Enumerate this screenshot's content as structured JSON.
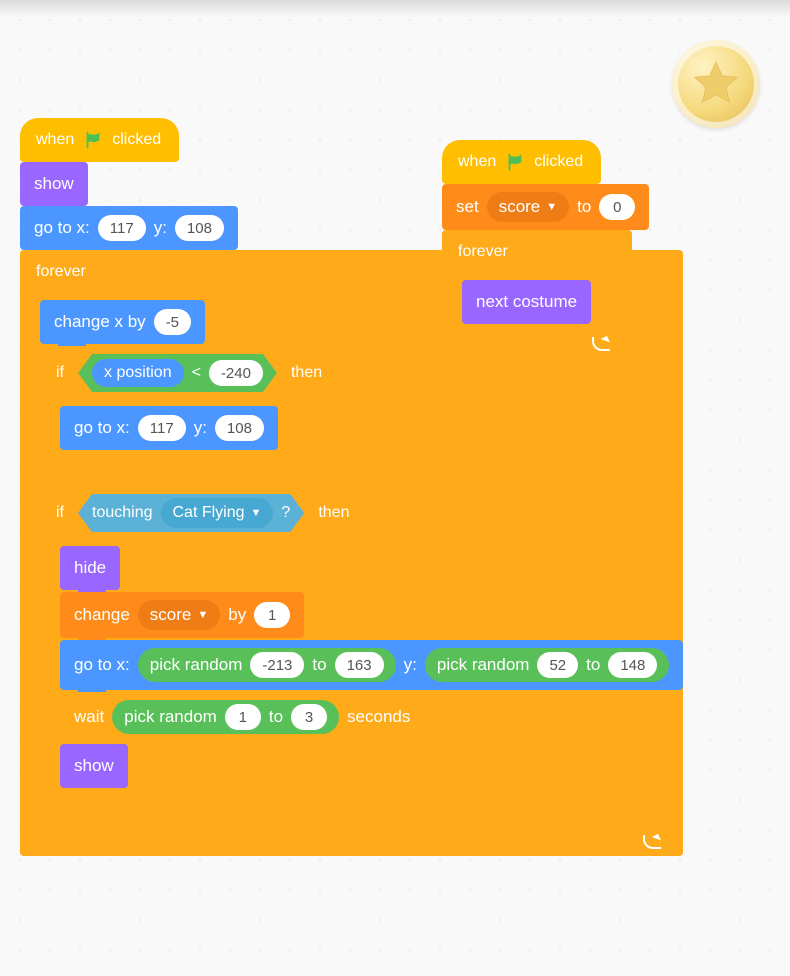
{
  "badge": {
    "name": "star-coin"
  },
  "hat": {
    "when": "when",
    "clicked": "clicked"
  },
  "looks": {
    "show": "show",
    "hide": "hide",
    "next_costume": "next costume"
  },
  "motion": {
    "goto_prefix": "go to x:",
    "goto_y": "y:",
    "change_x_by": "change x by",
    "x_position": "x position"
  },
  "control": {
    "forever": "forever",
    "if": "if",
    "then": "then",
    "wait": "wait",
    "seconds": "seconds"
  },
  "data": {
    "set": "set",
    "to": "to",
    "change": "change",
    "by": "by",
    "var": "score"
  },
  "sensing": {
    "touching": "touching",
    "q": "?",
    "target": "Cat Flying"
  },
  "operators": {
    "lt": "<",
    "pick_random": "pick random",
    "to": "to"
  },
  "values": {
    "goto1_x": "117",
    "goto1_y": "108",
    "change_x": "-5",
    "lt_rhs": "-240",
    "goto2_x": "117",
    "goto2_y": "108",
    "score_init": "0",
    "change_score": "1",
    "rand_x_lo": "-213",
    "rand_x_hi": "163",
    "rand_y_lo": "52",
    "rand_y_hi": "148",
    "wait_lo": "1",
    "wait_hi": "3"
  }
}
